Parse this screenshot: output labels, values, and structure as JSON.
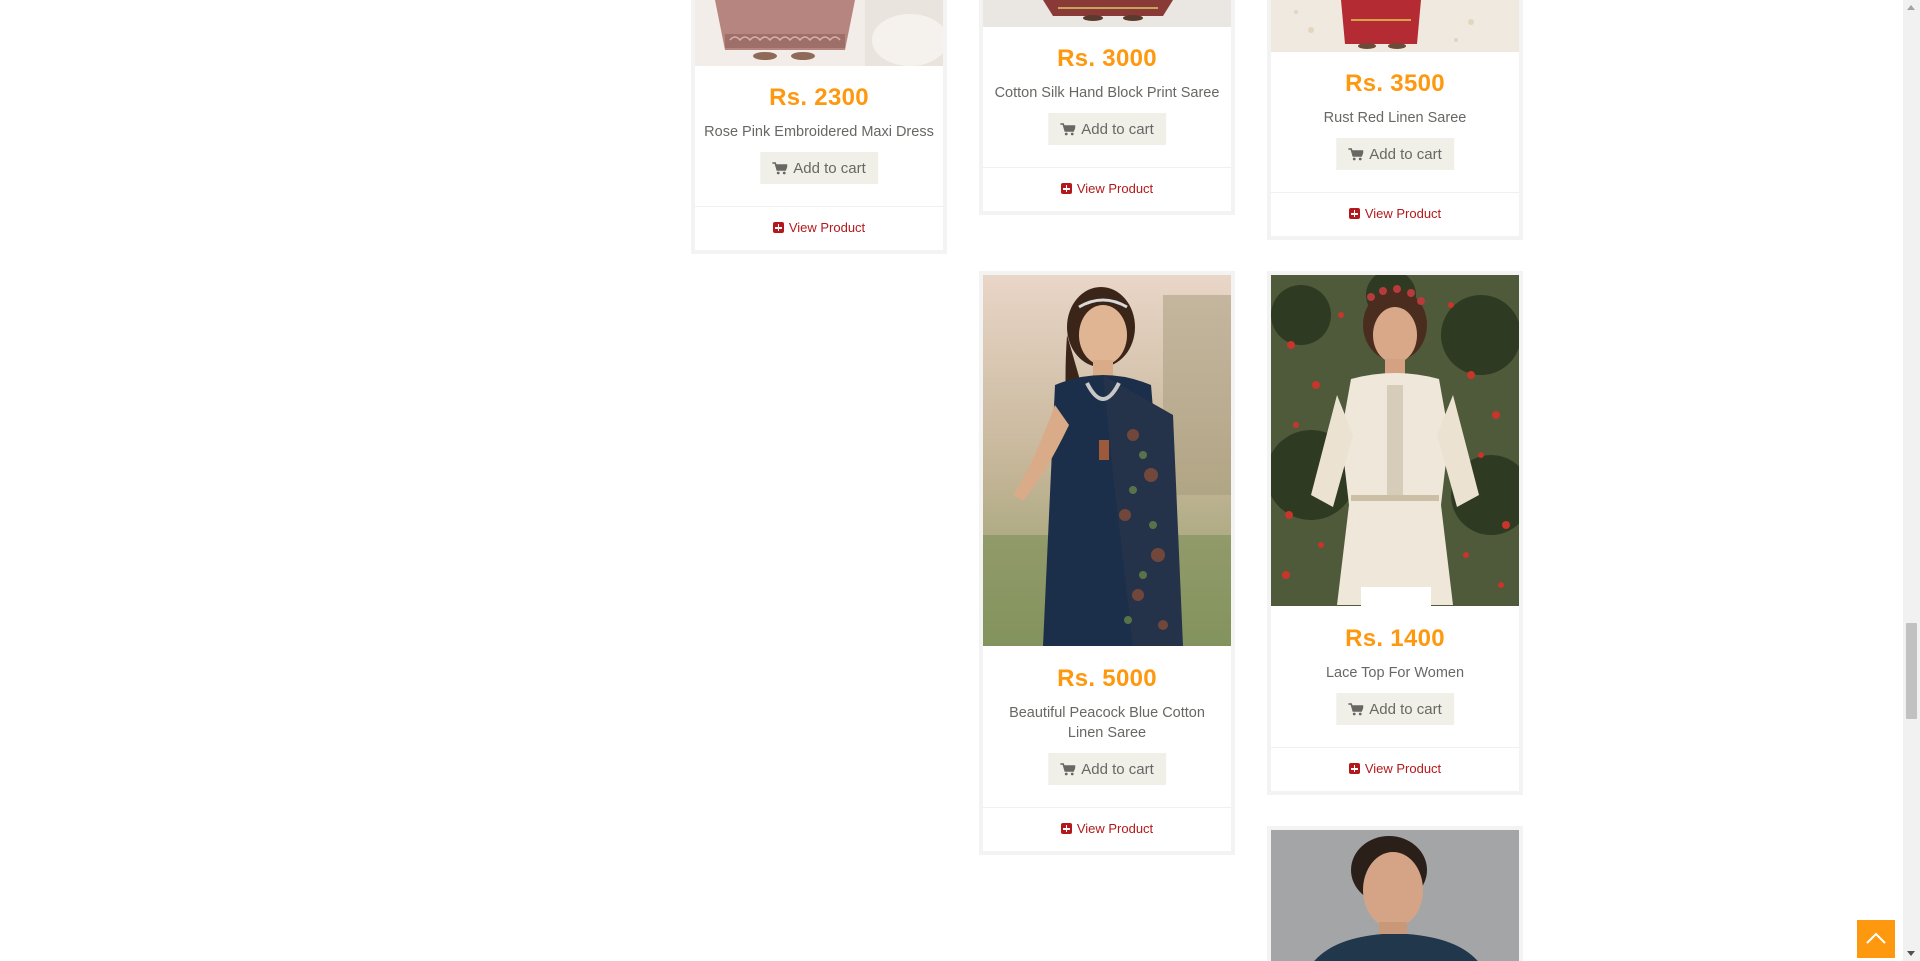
{
  "products": [
    {
      "price": "Rs. 2300",
      "name": "Rose Pink Embroidered Maxi Dress",
      "add_to_cart": "Add to cart",
      "view_product": "View Product"
    },
    {
      "price": "Rs. 3000",
      "name": "Cotton Silk Hand Block Print Saree",
      "add_to_cart": "Add to cart",
      "view_product": "View Product"
    },
    {
      "price": "Rs. 3500",
      "name": "Rust Red Linen Saree",
      "add_to_cart": "Add to cart",
      "view_product": "View Product"
    },
    {
      "price": "Rs. 5000",
      "name": "Beautiful Peacock Blue Cotton Linen Saree",
      "add_to_cart": "Add to cart",
      "view_product": "View Product"
    },
    {
      "price": "Rs. 1400",
      "name": "Lace Top For Women",
      "add_to_cart": "Add to cart",
      "view_product": "View Product"
    }
  ],
  "colors": {
    "price": "#FE980F",
    "link": "#B3191C",
    "button_bg": "#F0F0E9",
    "text": "#696763",
    "scroll_top_button": "#FE980F"
  },
  "icons": [
    "cart-icon",
    "plus-square-icon",
    "chevron-up-icon"
  ]
}
